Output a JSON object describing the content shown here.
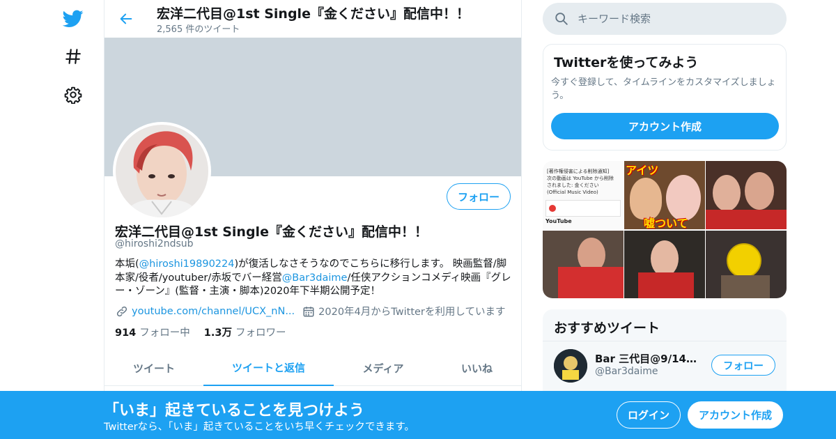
{
  "colors": {
    "accent": "#1da1f2",
    "link": "#1b95e0",
    "banner": "#ccd6dd",
    "muted": "#657786"
  },
  "nav": {
    "icons": [
      "twitter-bird-icon",
      "hashtag-icon",
      "gear-icon"
    ]
  },
  "header": {
    "title": "宏洋二代目@1st Single『金ください』配信中！！",
    "tweet_count": "2,565 件のツイート"
  },
  "profile": {
    "follow_label": "フォロー",
    "name": "宏洋二代目@1st Single『金ください』配信中！！",
    "handle": "@hiroshi2ndsub",
    "bio": {
      "t1": "本垢(",
      "mention1": "@hiroshi19890224",
      "t2": ")が復活しなさそうなのでこちらに移行します。 映画監督/脚本家/役者/youtuber/赤坂でバー経営",
      "mention2": "@Bar3daime",
      "t3": "/任侠アクションコメディ映画『グレー・ゾーン』(監督・主演・脚本)2020年下半期公開予定！"
    },
    "website": "youtube.com/channel/UCX_nN...",
    "joined": "2020年4月からTwitterを利用しています",
    "following_count": "914",
    "following_label": "フォロー中",
    "followers_count": "1.3万",
    "followers_label": "フォロワー"
  },
  "tabs": [
    {
      "label": "ツイート"
    },
    {
      "label": "ツイートと返信"
    },
    {
      "label": "メディア"
    },
    {
      "label": "いいね"
    }
  ],
  "active_tab": "ツイートと返信",
  "search": {
    "placeholder": "キーワード検索"
  },
  "signup": {
    "title": "Twitterを使ってみよう",
    "description": "今すぐ登録して、タイムラインをカスタマイズしましょう。",
    "button": "アカウント作成"
  },
  "media": {
    "cell1": {
      "notice": "[著作権侵害による削除通知]次の動画は YouTube から削除されました: 金ください (Official Music Video)",
      "footer": "YouTube"
    },
    "cell2": {
      "caption_top": "アイツ",
      "caption_bottom": "嘘ついて"
    }
  },
  "recommended": {
    "title": "おすすめツイート",
    "name": "Bar 三代目@9/14セ...",
    "handle": "@Bar3daime",
    "follow_label": "フォロー"
  },
  "bottom_bar": {
    "title": "「いま」起きていることを見つけよう",
    "subtitle": "Twitterなら、「いま」起きていることをいち早くチェックできます。",
    "login": "ログイン",
    "create": "アカウント作成"
  }
}
